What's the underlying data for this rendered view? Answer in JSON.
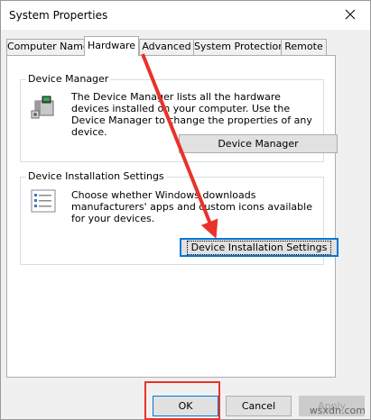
{
  "window": {
    "title": "System Properties"
  },
  "tabs": [
    {
      "label": "Computer Name",
      "active": false
    },
    {
      "label": "Hardware",
      "active": true
    },
    {
      "label": "Advanced",
      "active": false
    },
    {
      "label": "System Protection",
      "active": false
    },
    {
      "label": "Remote",
      "active": false
    }
  ],
  "device_manager": {
    "title": "Device Manager",
    "description": "The Device Manager lists all the hardware devices installed on your computer. Use the Device Manager to change the properties of any device.",
    "button_label": "Device Manager"
  },
  "device_installation": {
    "title": "Device Installation Settings",
    "description": "Choose whether Windows downloads manufacturers' apps and custom icons available for your devices.",
    "button_label": "Device Installation Settings"
  },
  "buttons": {
    "ok": "OK",
    "cancel": "Cancel",
    "apply": "Apply"
  },
  "watermark": "wsxdn.com",
  "colors": {
    "annotation_red": "#e8332a",
    "accent": "#0078d7"
  }
}
